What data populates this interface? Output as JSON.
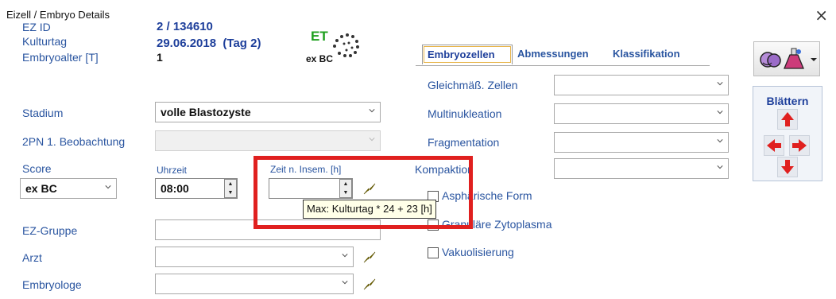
{
  "window": {
    "title": "Eizell / Embryo Details",
    "close_symbol": "×"
  },
  "info": {
    "ez_id_label": "EZ ID",
    "ez_id_value": "2 / 134610",
    "kulturtag_label": "Kulturtag",
    "kulturtag_value": "29.06.2018  (Tag 2)",
    "embryoalter_label": "Embryoalter [T]",
    "embryoalter_value": "1",
    "et_label": "ET",
    "ex_bc_label": "ex BC"
  },
  "form": {
    "stadium_label": "Stadium",
    "stadium_value": "volle Blastozyste",
    "pn_label": "2PN 1. Beobachtung",
    "pn_value": "",
    "score_label": "Score",
    "score_value": "ex BC",
    "uhrzeit_label": "Uhrzeit",
    "uhrzeit_value": "08:00",
    "zeit_label": "Zeit n. Insem. [h]",
    "zeit_value": "",
    "ez_gruppe_label": "EZ-Gruppe",
    "ez_gruppe_value": "",
    "arzt_label": "Arzt",
    "arzt_value": "",
    "embryologe_label": "Embryologe",
    "embryologe_value": ""
  },
  "tooltip": {
    "text": "Max: Kulturtag * 24 + 23 [h]"
  },
  "tabs": [
    {
      "label": "Embryozellen",
      "active": true
    },
    {
      "label": "Abmessungen",
      "active": false
    },
    {
      "label": "Klassifikation",
      "active": false
    }
  ],
  "embryozellen": {
    "gleichmass_label": "Gleichmäß. Zellen",
    "multinukleation_label": "Multinukleation",
    "fragmentation_label": "Fragmentation",
    "kompaktion_label": "Kompaktion",
    "checkboxes": [
      {
        "label": "Asphärische Form",
        "checked": false
      },
      {
        "label": "Granuläre Zytoplasma",
        "checked": false
      },
      {
        "label": "Vakuolisierung",
        "checked": false
      }
    ]
  },
  "navigation": {
    "title": "Blättern"
  },
  "colors": {
    "accent_red": "#e0201f",
    "label_blue": "#2a55a0",
    "et_green": "#1ea01e"
  }
}
